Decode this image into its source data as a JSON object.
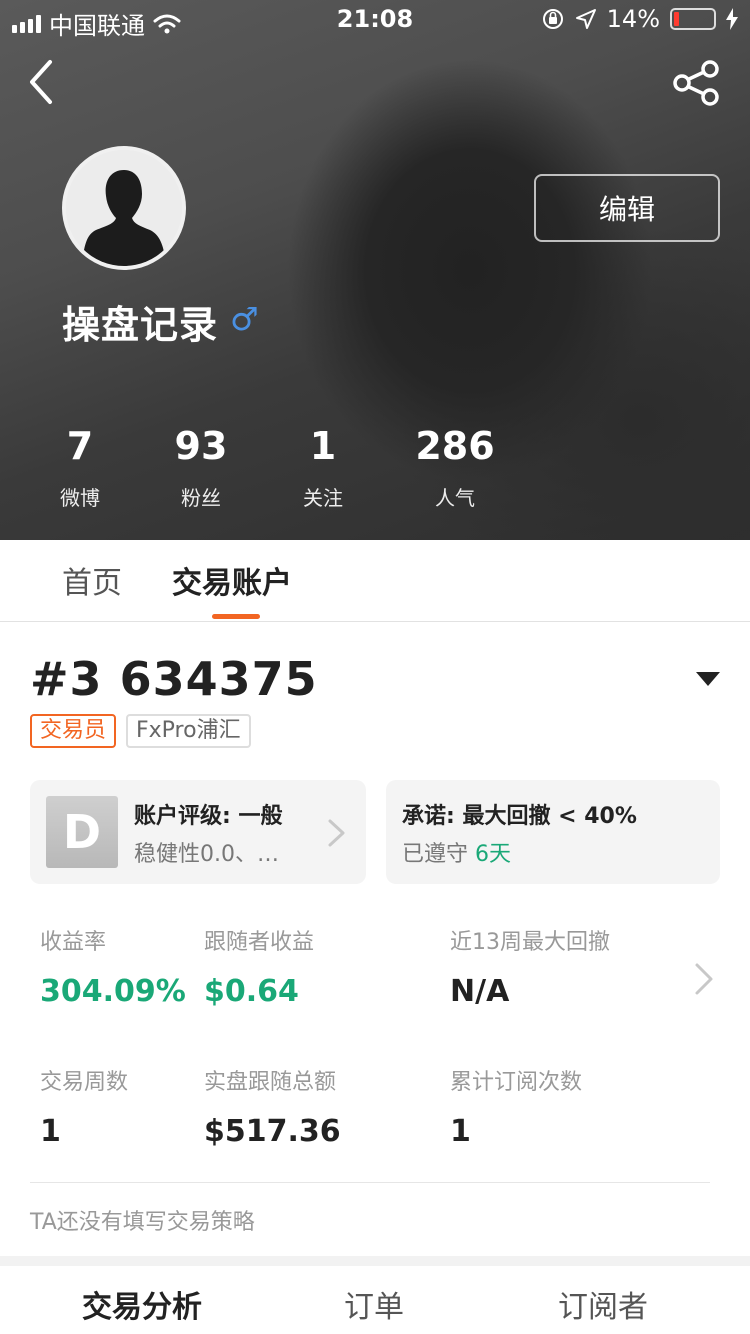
{
  "status_bar": {
    "carrier": "中国联通",
    "time": "21:08",
    "battery_percent": "14%",
    "battery_level": 0.14
  },
  "profile": {
    "name": "操盘记录",
    "gender_symbol": "♂",
    "edit_label": "编辑"
  },
  "stats": [
    {
      "value": "7",
      "label": "微博"
    },
    {
      "value": "93",
      "label": "粉丝"
    },
    {
      "value": "1",
      "label": "关注"
    },
    {
      "value": "286",
      "label": "人气"
    }
  ],
  "tabs": [
    {
      "label": "首页",
      "active": false
    },
    {
      "label": "交易账户",
      "active": true
    }
  ],
  "account": {
    "number": "#3 634375",
    "tags": [
      "交易员",
      "FxPro浦汇"
    ],
    "rating": {
      "grade": "D",
      "title": "账户评级: 一般",
      "subtitle": "稳健性0.0、…"
    },
    "promise": {
      "title": "承诺: 最大回撤 < 40%",
      "kept_prefix": "已遵守",
      "kept_days": "6天"
    }
  },
  "metrics": [
    {
      "label": "收益率",
      "value": "304.09%",
      "highlight": true
    },
    {
      "label": "跟随者收益",
      "value": "$0.64",
      "highlight": true
    },
    {
      "label": "近13周最大回撤",
      "value": "N/A",
      "highlight": false
    },
    {
      "label": "交易周数",
      "value": "1",
      "highlight": false
    },
    {
      "label": "实盘跟随总额",
      "value": "$517.36",
      "highlight": false
    },
    {
      "label": "累计订阅次数",
      "value": "1",
      "highlight": false
    }
  ],
  "strategy_text": "TA还没有填写交易策略",
  "subtabs": [
    {
      "label": "交易分析",
      "active": true
    },
    {
      "label": "订单",
      "active": false
    },
    {
      "label": "订阅者",
      "active": false
    }
  ],
  "colors": {
    "accent": "#f26522",
    "positive": "#1aa877",
    "gender": "#4a90e2"
  }
}
